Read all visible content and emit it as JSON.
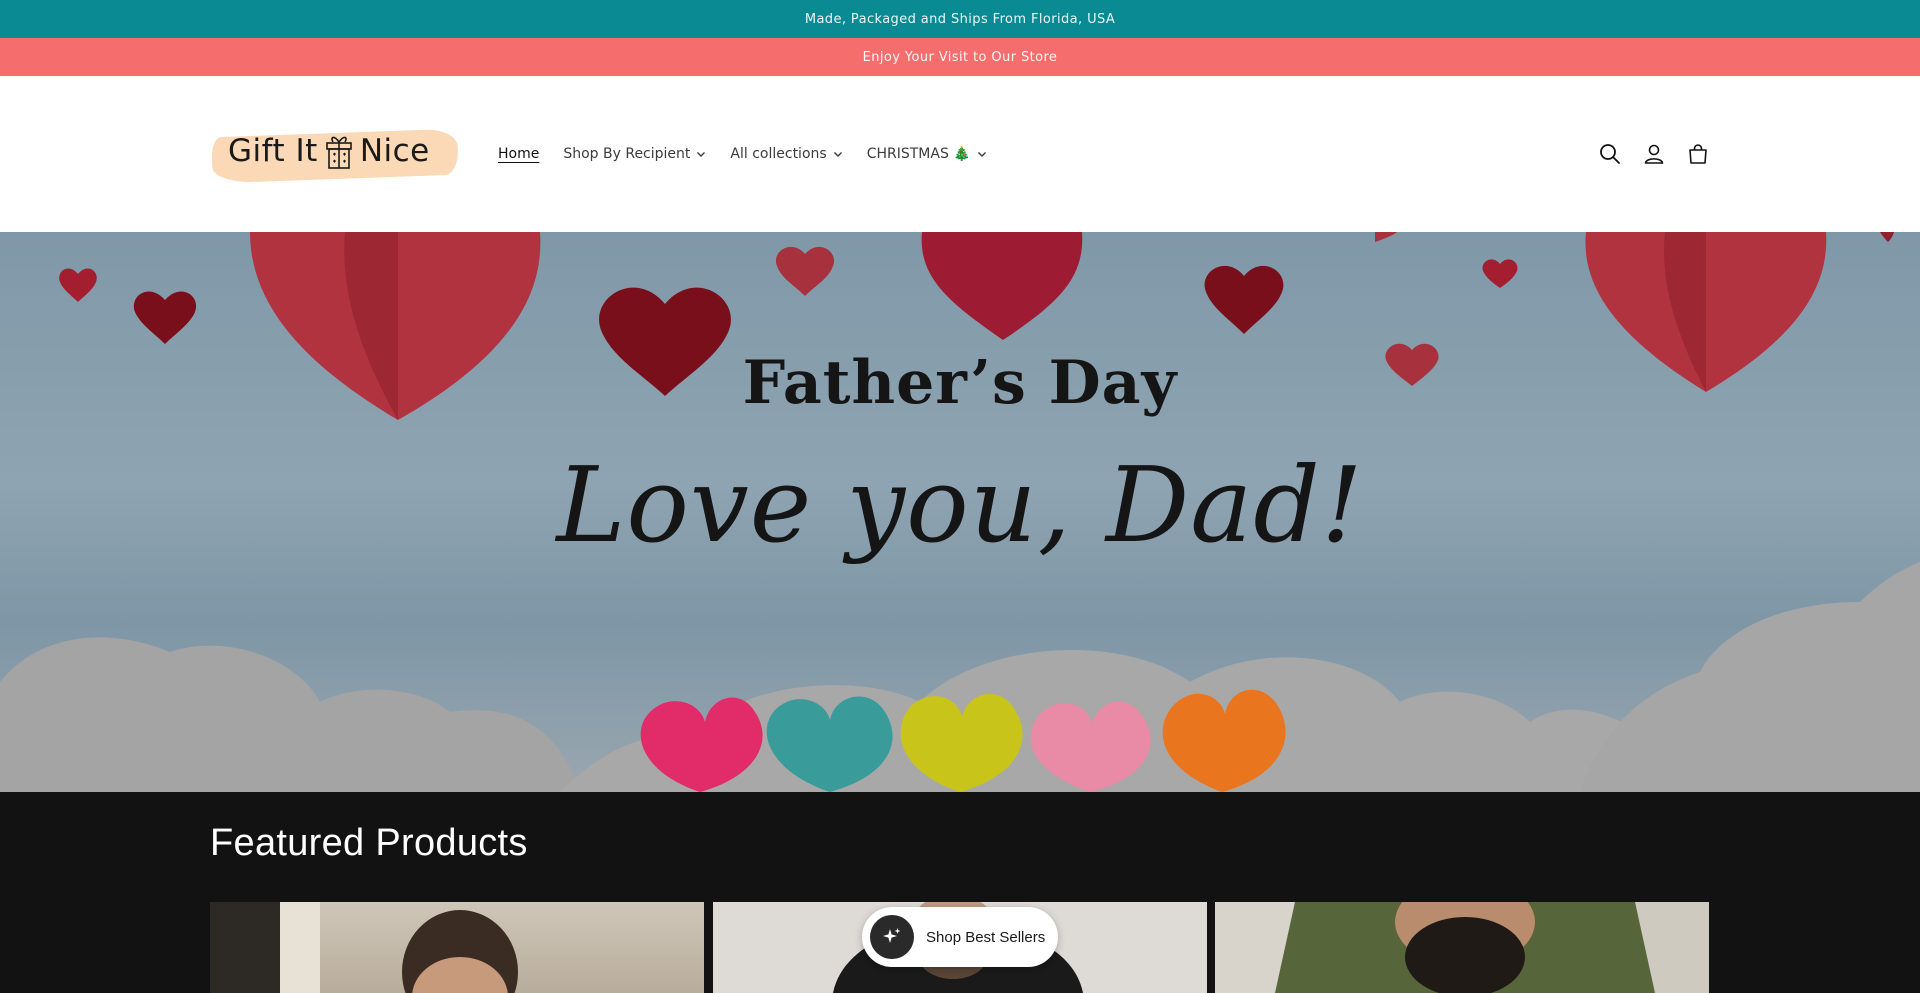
{
  "announcements": {
    "top": "Made, Packaged and Ships From Florida, USA",
    "second": "Enjoy Your Visit to Our Store"
  },
  "header": {
    "logo": {
      "text_left": "Gift It",
      "text_right": "Nice",
      "icon": "gift-box-icon"
    },
    "nav": [
      {
        "label": "Home",
        "active": true,
        "dropdown": false
      },
      {
        "label": "Shop By Recipient",
        "active": false,
        "dropdown": true
      },
      {
        "label": "All collections",
        "active": false,
        "dropdown": true
      },
      {
        "label": "CHRISTMAS 🎄",
        "active": false,
        "dropdown": true
      }
    ],
    "icons": [
      "search-icon",
      "account-icon",
      "cart-icon"
    ]
  },
  "hero": {
    "line1": "Father’s Day",
    "line2": "Love you, Dad!",
    "colors": {
      "heart_red": "#a02a35",
      "heart_dark": "#7a0f1c",
      "cloud": "#a9a9a9"
    }
  },
  "featured": {
    "heading": "Featured Products"
  },
  "floating": {
    "label": "Shop Best Sellers",
    "icon": "sparkle-icon"
  },
  "colors": {
    "announce_teal": "#0a8a92",
    "announce_coral": "#f66d6d",
    "featured_bg": "#121212",
    "logo_brush": "#fbd9b6"
  }
}
